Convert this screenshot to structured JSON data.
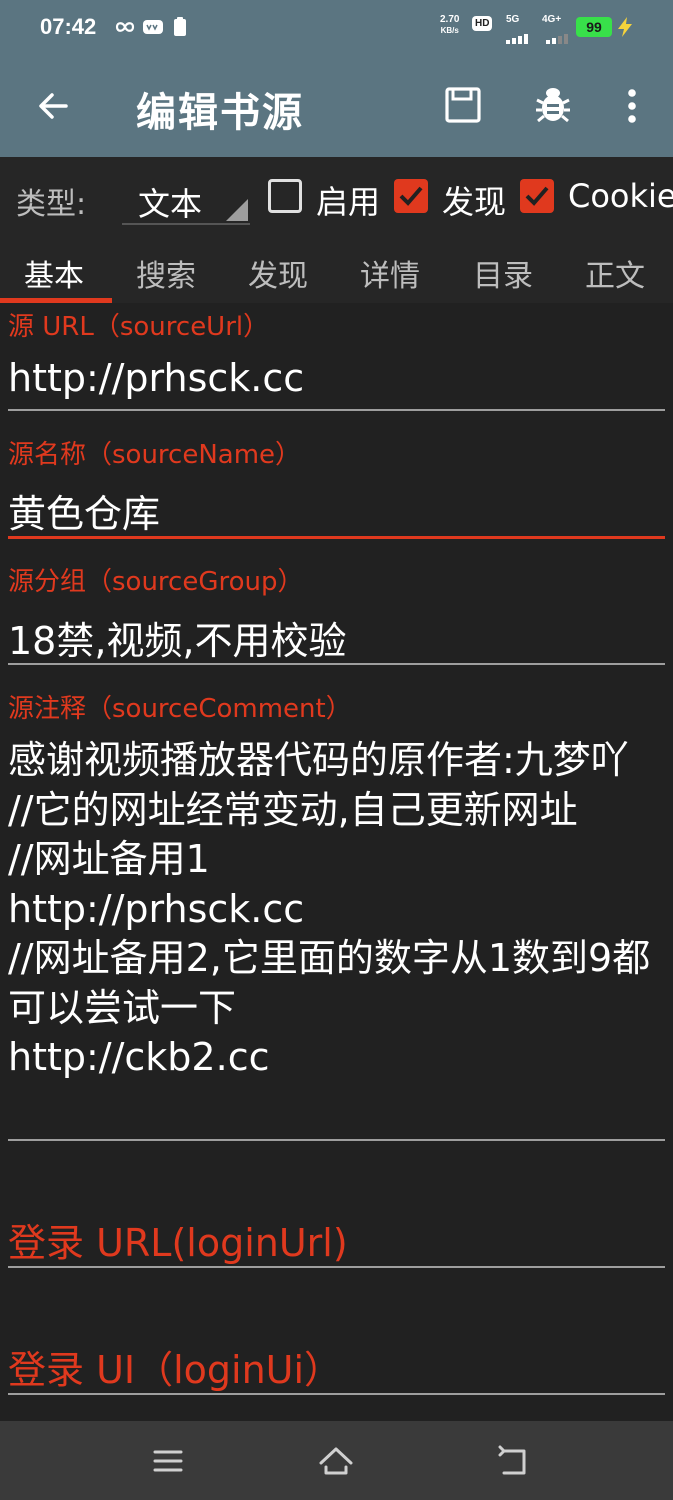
{
  "status_bar": {
    "time": "07:42",
    "speed_value": "2.70",
    "speed_unit": "KB/s",
    "hd_label": "HD",
    "net_5g": "5G",
    "net_4g": "4G+",
    "battery": "99"
  },
  "toolbar": {
    "title": "编辑书源"
  },
  "type_row": {
    "label": "类型:",
    "value": "文本",
    "enable_label": "启用",
    "enable_checked": false,
    "discover_label": "发现",
    "discover_checked": true,
    "cookie_label": "Cookie",
    "cookie_checked": true
  },
  "tabs": [
    {
      "label": "基本",
      "active": true
    },
    {
      "label": "搜索",
      "active": false
    },
    {
      "label": "发现",
      "active": false
    },
    {
      "label": "详情",
      "active": false
    },
    {
      "label": "目录",
      "active": false
    },
    {
      "label": "正文",
      "active": false
    }
  ],
  "fields": {
    "source_url": {
      "label": "源 URL（sourceUrl）",
      "value": "http://prhsck.cc"
    },
    "source_name": {
      "label": "源名称（sourceName）",
      "value": "黄色仓库"
    },
    "source_group": {
      "label": "源分组（sourceGroup）",
      "value": "18禁,视频,不用校验"
    },
    "source_comment": {
      "label": "源注释（sourceComment）",
      "value": "感谢视频播放器代码的原作者:九梦吖\n//它的网址经常变动,自己更新网址\n//网址备用1\nhttp://prhsck.cc\n//网址备用2,它里面的数字从1数到9都可以尝试一下\nhttp://ckb2.cc"
    },
    "login_url": {
      "placeholder": "登录 URL(loginUrl)"
    },
    "login_ui": {
      "placeholder": "登录 UI（loginUi）"
    }
  },
  "colors": {
    "toolbar": "#5b7581",
    "accent": "#e0391e",
    "background": "#212121"
  }
}
